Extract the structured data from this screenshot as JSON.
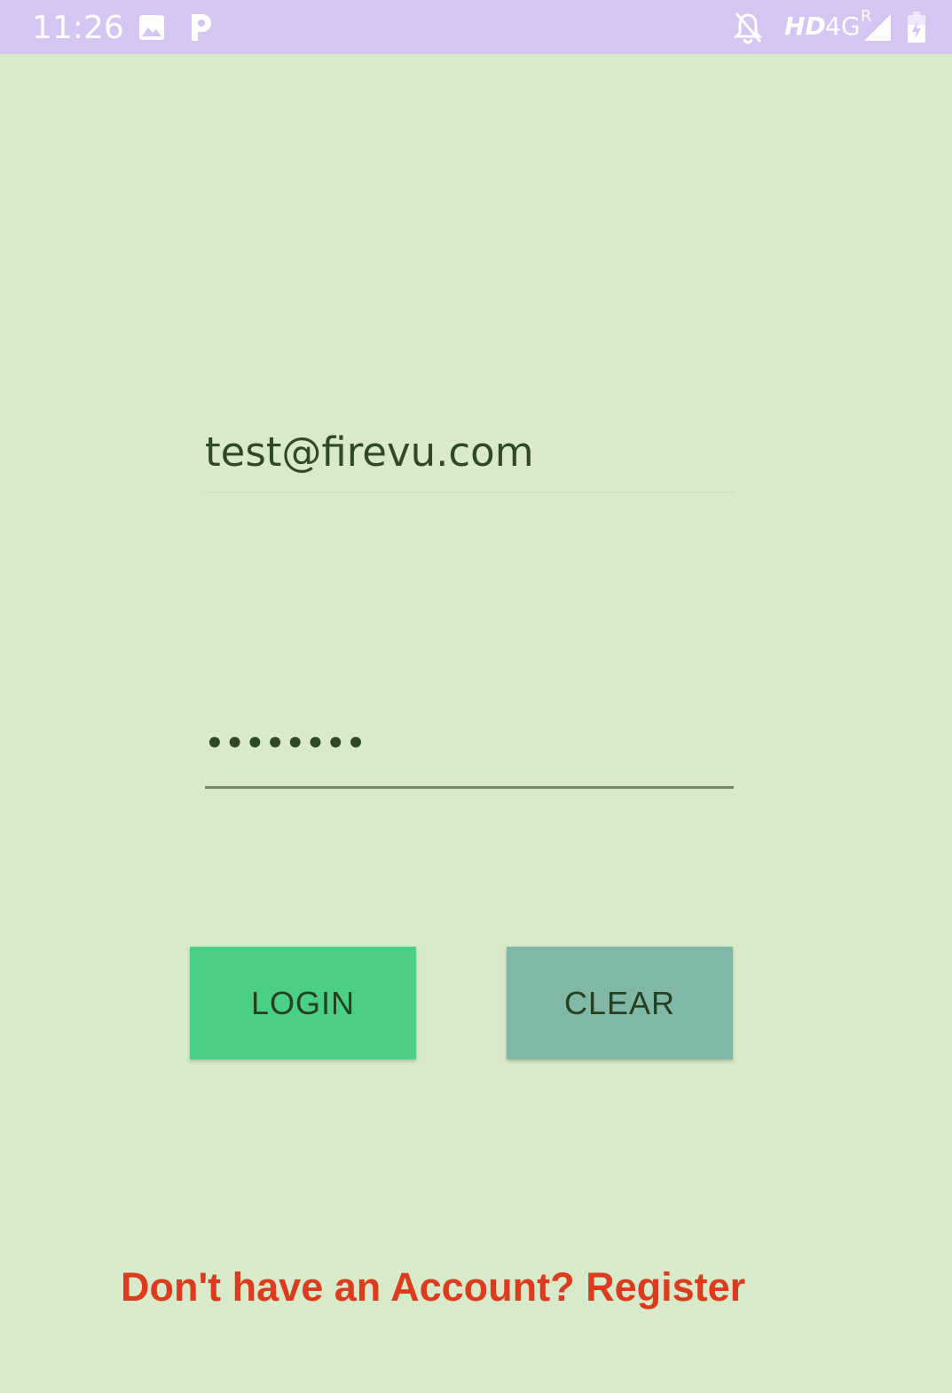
{
  "status_bar": {
    "time": "11:26",
    "network_hd": "HD",
    "network_type": "4G",
    "roaming": "R",
    "icons": [
      "image-icon",
      "parking-app-icon",
      "notifications-off-icon",
      "signal-icon",
      "battery-charging-icon"
    ],
    "background_color": "#d5c5f2"
  },
  "login_form": {
    "email_value": "test@firevu.com",
    "password_value": "••••••••",
    "login_label": "LOGIN",
    "clear_label": "CLEAR",
    "register_text": "Don't have an Account? Register"
  },
  "colors": {
    "background": "#d9eacb",
    "login_button": "#4bcf87",
    "clear_button": "#80b8a7",
    "register_link": "#dd3b1e",
    "text": "#2e4a24"
  }
}
